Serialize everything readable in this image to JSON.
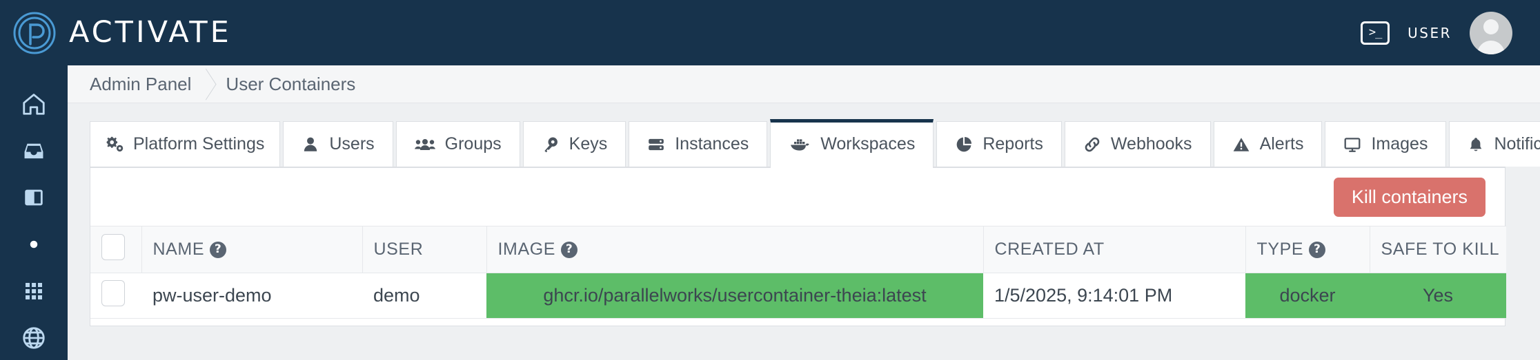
{
  "header": {
    "brand_name": "ACTIVATE",
    "logo_icon": "parallel-works-fingerprint-logo",
    "terminal_icon": ">_",
    "terminal_icon_name": "terminal-icon",
    "user_label": "USER",
    "avatar_icon": "user-avatar-icon",
    "background_color": "#17334c"
  },
  "sidebar": {
    "items": [
      {
        "icon": "home-icon",
        "name": "sidebar-item-home"
      },
      {
        "icon": "inbox-icon",
        "name": "sidebar-item-inbox"
      },
      {
        "icon": "panel-icon",
        "name": "sidebar-item-panel"
      },
      {
        "icon": "dot-icon",
        "name": "sidebar-item-dot"
      },
      {
        "icon": "grid-icon",
        "name": "sidebar-item-grid"
      },
      {
        "icon": "globe-icon",
        "name": "sidebar-item-globe"
      }
    ]
  },
  "breadcrumb": {
    "items": [
      "Admin Panel",
      "User Containers"
    ],
    "separator_icon": "chevron-right-icon"
  },
  "tabs": [
    {
      "label": "Platform Settings",
      "icon": "cogs-icon",
      "active": false,
      "two_line": true
    },
    {
      "label": "Users",
      "icon": "user-icon",
      "active": false,
      "two_line": false
    },
    {
      "label": "Groups",
      "icon": "users-icon",
      "active": false,
      "two_line": false
    },
    {
      "label": "Keys",
      "icon": "key-icon",
      "active": false,
      "two_line": false
    },
    {
      "label": "Instances",
      "icon": "server-icon",
      "active": false,
      "two_line": false
    },
    {
      "label": "Workspaces",
      "icon": "docker-whale-icon",
      "active": true,
      "two_line": false
    },
    {
      "label": "Reports",
      "icon": "pie-chart-icon",
      "active": false,
      "two_line": false
    },
    {
      "label": "Webhooks",
      "icon": "link-icon",
      "active": false,
      "two_line": false
    },
    {
      "label": "Alerts",
      "icon": "warning-triangle-icon",
      "active": false,
      "two_line": false
    },
    {
      "label": "Images",
      "icon": "monitor-icon",
      "active": false,
      "two_line": false
    },
    {
      "label": "Notifications",
      "icon": "bell-icon",
      "active": false,
      "two_line": false
    }
  ],
  "toolbar": {
    "kill_label": "Kill containers",
    "kill_color": "#d9726c"
  },
  "table": {
    "columns": [
      {
        "label": "",
        "key": "check",
        "help": false
      },
      {
        "label": "NAME",
        "key": "name",
        "help": true
      },
      {
        "label": "USER",
        "key": "user",
        "help": false
      },
      {
        "label": "IMAGE",
        "key": "image",
        "help": true
      },
      {
        "label": "CREATED AT",
        "key": "created_at",
        "help": false
      },
      {
        "label": "TYPE",
        "key": "type",
        "help": true
      },
      {
        "label": "SAFE TO KILL",
        "key": "safe_to_kill",
        "help": false
      }
    ],
    "rows": [
      {
        "name": "pw-user-demo",
        "user": "demo",
        "image": "ghcr.io/parallelworks/usercontainer-theia:latest",
        "created_at": "1/5/2025, 9:14:01 PM",
        "type": "docker",
        "safe_to_kill": "Yes"
      }
    ],
    "highlight_color": "#5dbd68"
  }
}
